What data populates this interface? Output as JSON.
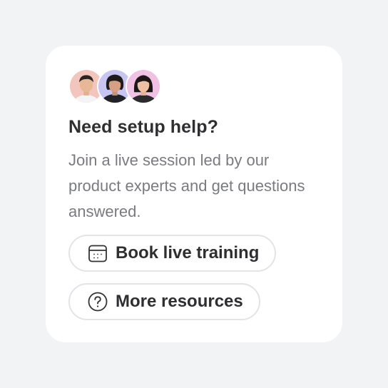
{
  "card": {
    "title": "Need setup help?",
    "description": "Join a live session led by our product experts and get questions answered.",
    "avatars": [
      {
        "bg": "#f3c6bd"
      },
      {
        "bg": "#c9c5f2"
      },
      {
        "bg": "#f1c1e4"
      }
    ],
    "buttons": {
      "book_training": {
        "label": "Book live training",
        "icon": "calendar-icon"
      },
      "more_resources": {
        "label": "More resources",
        "icon": "question-circle-icon"
      }
    }
  },
  "colors": {
    "page_bg": "#f2f3f5",
    "card_bg": "#ffffff",
    "title": "#2f2f32",
    "description": "#7a7b80",
    "button_border": "#e3e4e8"
  }
}
